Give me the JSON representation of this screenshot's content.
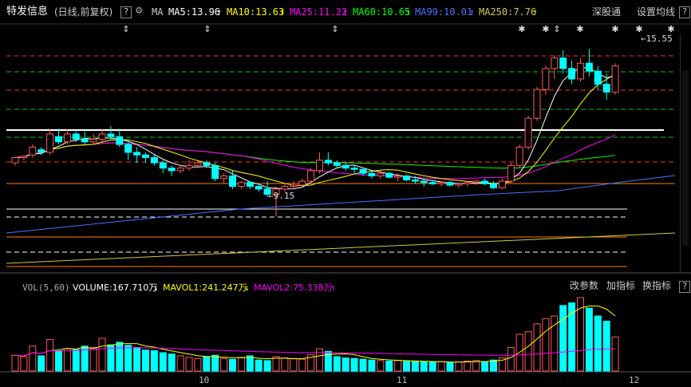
{
  "header": {
    "stock_name": "特发信息",
    "period": "(日线,前复权)",
    "help_label": "?",
    "ma_label": "MA",
    "ma5": "MA5:13.96",
    "ma10": "MA10:13.63",
    "ma25": "MA25:11.22",
    "ma60": "MA60:10.65",
    "ma99": "MA99:10.01",
    "ma250": "MA250:7.76",
    "exchange_button": "深股通",
    "settings_button": "设置均线"
  },
  "colors": {
    "background": "#000000",
    "up": "#ff5a5a",
    "down": "#00ffff",
    "ma5": "#ffffff",
    "ma10": "#ffff00",
    "ma25": "#ff00ff",
    "ma60": "#00ff00",
    "ma99": "#4f6fff",
    "ma250": "#cccc44",
    "hline_red": "#ff3030",
    "hline_green": "#00cc00",
    "hline_orange": "#ff8000"
  },
  "annotations": {
    "high_label": "15.55",
    "low_label": "9.15"
  },
  "volume": {
    "label": "VOL(5,60)",
    "volume_value": "VOLUME:167.710万",
    "mavol1": "MAVOL1:241.247万",
    "mavol2": "MAVOL2:75.338万",
    "change_params": "改参数",
    "add_indicator": "加指标",
    "switch_indicator": "换指标",
    "help_label": "?"
  },
  "date_axis": [
    "10",
    "11",
    "12"
  ],
  "chart_data": {
    "type": "candlestick",
    "price_range": [
      7.0,
      16.5
    ],
    "candles": [
      [
        11.2,
        11.4,
        11.1,
        11.4
      ],
      [
        11.4,
        11.5,
        11.3,
        11.45
      ],
      [
        11.5,
        11.9,
        11.4,
        11.8
      ],
      [
        11.7,
        11.8,
        11.5,
        11.6
      ],
      [
        11.6,
        12.5,
        11.5,
        12.3
      ],
      [
        12.2,
        12.5,
        11.9,
        12.0
      ],
      [
        12.0,
        12.5,
        11.9,
        12.3
      ],
      [
        12.3,
        12.4,
        12.0,
        12.1
      ],
      [
        12.1,
        12.4,
        11.9,
        12.0
      ],
      [
        12.0,
        12.3,
        11.9,
        12.1
      ],
      [
        12.1,
        12.5,
        12.0,
        12.3
      ],
      [
        12.3,
        12.6,
        12.1,
        12.2
      ],
      [
        12.2,
        12.5,
        11.8,
        11.9
      ],
      [
        11.9,
        12.1,
        11.3,
        11.6
      ],
      [
        11.6,
        11.8,
        11.2,
        11.5
      ],
      [
        11.5,
        11.6,
        11.2,
        11.4
      ],
      [
        11.4,
        11.5,
        11.1,
        11.2
      ],
      [
        11.2,
        11.3,
        10.8,
        11.0
      ],
      [
        11.0,
        11.1,
        10.7,
        10.9
      ],
      [
        10.9,
        11.1,
        10.8,
        11.0
      ],
      [
        11.0,
        11.3,
        10.9,
        11.1
      ],
      [
        11.1,
        11.3,
        11.0,
        11.2
      ],
      [
        11.2,
        11.3,
        11.0,
        11.1
      ],
      [
        11.1,
        11.2,
        10.5,
        10.6
      ],
      [
        10.6,
        10.8,
        10.4,
        10.7
      ],
      [
        10.7,
        10.9,
        10.2,
        10.3
      ],
      [
        10.3,
        10.5,
        10.2,
        10.45
      ],
      [
        10.45,
        10.5,
        10.2,
        10.3
      ],
      [
        10.3,
        10.4,
        10.1,
        10.2
      ],
      [
        10.2,
        10.5,
        9.9,
        10.0
      ],
      [
        10.0,
        10.3,
        9.15,
        10.2
      ],
      [
        10.2,
        10.4,
        10.1,
        10.3
      ],
      [
        10.3,
        10.5,
        10.2,
        10.35
      ],
      [
        10.35,
        10.6,
        10.3,
        10.5
      ],
      [
        10.5,
        11.0,
        10.4,
        10.9
      ],
      [
        10.9,
        11.6,
        10.8,
        11.3
      ],
      [
        11.3,
        11.6,
        11.1,
        11.2
      ],
      [
        11.2,
        11.3,
        11.0,
        11.1
      ],
      [
        11.1,
        11.2,
        10.9,
        11.0
      ],
      [
        11.0,
        11.1,
        10.8,
        10.95
      ],
      [
        10.95,
        11.0,
        10.7,
        10.8
      ],
      [
        10.8,
        10.9,
        10.6,
        10.7
      ],
      [
        10.7,
        10.9,
        10.6,
        10.8
      ],
      [
        10.8,
        10.85,
        10.6,
        10.65
      ],
      [
        10.65,
        10.8,
        10.5,
        10.7
      ],
      [
        10.7,
        10.75,
        10.5,
        10.55
      ],
      [
        10.55,
        10.7,
        10.4,
        10.5
      ],
      [
        10.5,
        10.6,
        10.3,
        10.45
      ],
      [
        10.45,
        10.55,
        10.35,
        10.4
      ],
      [
        10.4,
        10.5,
        10.3,
        10.45
      ],
      [
        10.45,
        10.5,
        10.3,
        10.35
      ],
      [
        10.35,
        10.45,
        10.25,
        10.4
      ],
      [
        10.4,
        10.5,
        10.3,
        10.45
      ],
      [
        10.45,
        10.55,
        10.35,
        10.5
      ],
      [
        10.5,
        10.6,
        10.35,
        10.4
      ],
      [
        10.4,
        10.5,
        10.2,
        10.25
      ],
      [
        10.25,
        10.6,
        10.2,
        10.5
      ],
      [
        10.5,
        11.2,
        10.4,
        11.1
      ],
      [
        11.1,
        11.9,
        11.0,
        11.8
      ],
      [
        11.8,
        13.0,
        11.7,
        12.9
      ],
      [
        12.9,
        14.1,
        12.8,
        14.0
      ],
      [
        14.0,
        14.9,
        13.8,
        14.8
      ],
      [
        14.8,
        15.3,
        14.4,
        15.2
      ],
      [
        15.2,
        15.5,
        14.6,
        14.8
      ],
      [
        14.8,
        15.1,
        14.2,
        14.4
      ],
      [
        14.4,
        15.2,
        14.3,
        15.0
      ],
      [
        15.0,
        15.55,
        14.5,
        14.7
      ],
      [
        14.7,
        14.9,
        14.0,
        14.2
      ],
      [
        14.2,
        14.6,
        13.6,
        13.9
      ],
      [
        13.9,
        15.0,
        13.8,
        14.9
      ]
    ],
    "volumes": [
      60,
      55,
      95,
      58,
      120,
      75,
      85,
      82,
      95,
      90,
      125,
      100,
      110,
      98,
      90,
      80,
      78,
      70,
      65,
      58,
      52,
      48,
      55,
      60,
      48,
      45,
      50,
      58,
      42,
      40,
      55,
      50,
      48,
      45,
      62,
      85,
      75,
      55,
      50,
      48,
      45,
      42,
      40,
      38,
      40,
      38,
      36,
      35,
      34,
      36,
      32,
      35,
      38,
      40,
      36,
      42,
      50,
      90,
      140,
      150,
      180,
      200,
      210,
      250,
      260,
      280,
      240,
      210,
      190,
      130
    ]
  }
}
